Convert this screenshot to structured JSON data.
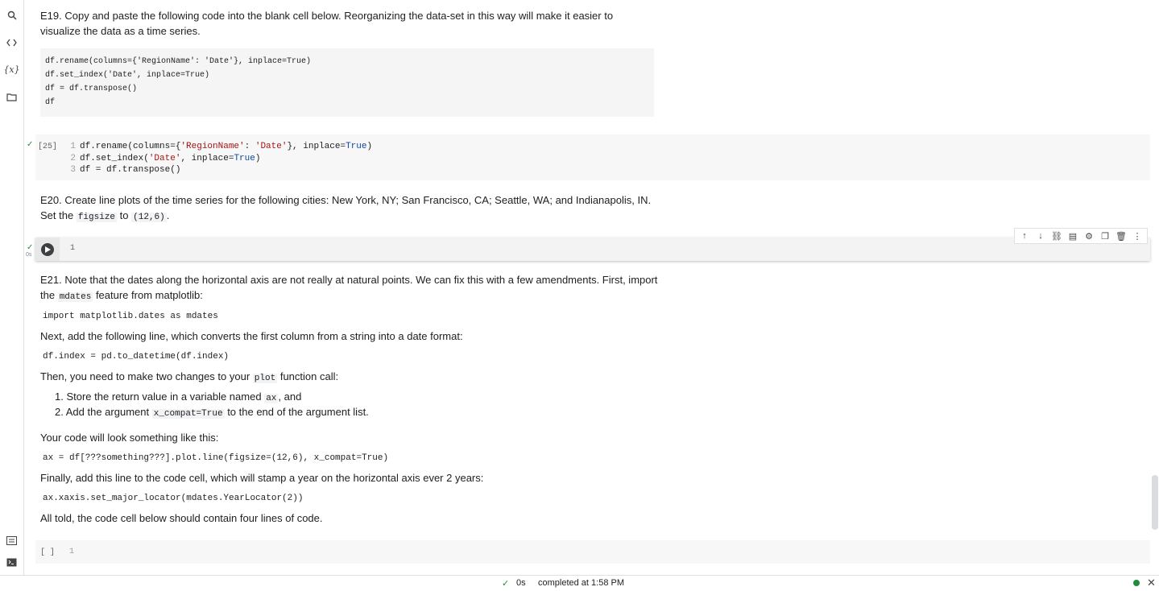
{
  "sidebar": {
    "icons": [
      "search-icon",
      "code-icon",
      "variables-icon",
      "folder-icon",
      "command-palette-icon",
      "terminal-icon"
    ],
    "variables_label": "{x}"
  },
  "e19": {
    "text": "E19. Copy and paste the following code into the blank cell below. Reorganizing the data-set in this way will make it easier to visualize the data as a time series.",
    "code_lines": [
      "df.rename(columns={'RegionName': 'Date'}, inplace=True)",
      "df.set_index('Date', inplace=True)",
      "df = df.transpose()",
      "df"
    ]
  },
  "cell25": {
    "exec_count": "[25]",
    "lines": [
      {
        "num": "1",
        "parts": [
          {
            "t": "df.rename(columns={",
            "c": ""
          },
          {
            "t": "'RegionName'",
            "c": "str"
          },
          {
            "t": ": ",
            "c": ""
          },
          {
            "t": "'Date'",
            "c": "str"
          },
          {
            "t": "}, inplace=",
            "c": ""
          },
          {
            "t": "True",
            "c": "kw"
          },
          {
            "t": ")",
            "c": ""
          }
        ]
      },
      {
        "num": "2",
        "parts": [
          {
            "t": "df.set_index(",
            "c": ""
          },
          {
            "t": "'Date'",
            "c": "str"
          },
          {
            "t": ", inplace=",
            "c": ""
          },
          {
            "t": "True",
            "c": "kw"
          },
          {
            "t": ")",
            "c": ""
          }
        ]
      },
      {
        "num": "3",
        "parts": [
          {
            "t": "df = df.transpose()",
            "c": ""
          }
        ]
      }
    ]
  },
  "e20": {
    "text_a": "E20. Create line plots of the time series for the following cities: New York, NY; San Francisco, CA; Seattle, WA; and Indianapolis, IN. Set the",
    "code_figsize": "figsize",
    "to": "to",
    "code_val": "(12,6)",
    "period": "."
  },
  "active_cell": {
    "line_num": "1",
    "time": "0s"
  },
  "toolbar": {
    "icons": [
      "move-up-icon",
      "move-down-icon",
      "link-icon",
      "comment-icon",
      "settings-icon",
      "mirror-cell-icon",
      "delete-icon",
      "more-icon"
    ]
  },
  "e21": {
    "p1": "E21. Note that the dates along the horizontal axis are not really at natural points. We can fix this with a few amendments. First, import the",
    "p1_code": "mdates",
    "p1_end": "feature from matplotlib:",
    "import_line": "import matplotlib.dates as mdates",
    "p2": "Next, add the following line, which converts the first column from a string into a date format:",
    "datetime_line": "df.index = pd.to_datetime(df.index)",
    "p3_a": "Then, you need to make two changes to your",
    "p3_code": "plot",
    "p3_b": "function call:",
    "li1_a": "Store the return value in a variable named",
    "li1_code": "ax",
    "li1_b": ", and",
    "li2_a": "Add the argument",
    "li2_code": "x_compat=True",
    "li2_b": "to the end of the argument list.",
    "p4": "Your code will look something like this:",
    "ax_line": "ax = df[???something???].plot.line(figsize=(12,6), x_compat=True)",
    "p5": "Finally, add this line to the code cell, which will stamp a year on the horizontal axis ever 2 years:",
    "locator_line": "ax.xaxis.set_major_locator(mdates.YearLocator(2))",
    "p6": "All told, the code cell below should contain four lines of code."
  },
  "empty_cell": {
    "exec": "[ ]",
    "line_num": "1"
  },
  "status": {
    "check": "✓",
    "time": "0s",
    "text": "completed at 1:58 PM",
    "dot_color": "#1e8e3e"
  }
}
